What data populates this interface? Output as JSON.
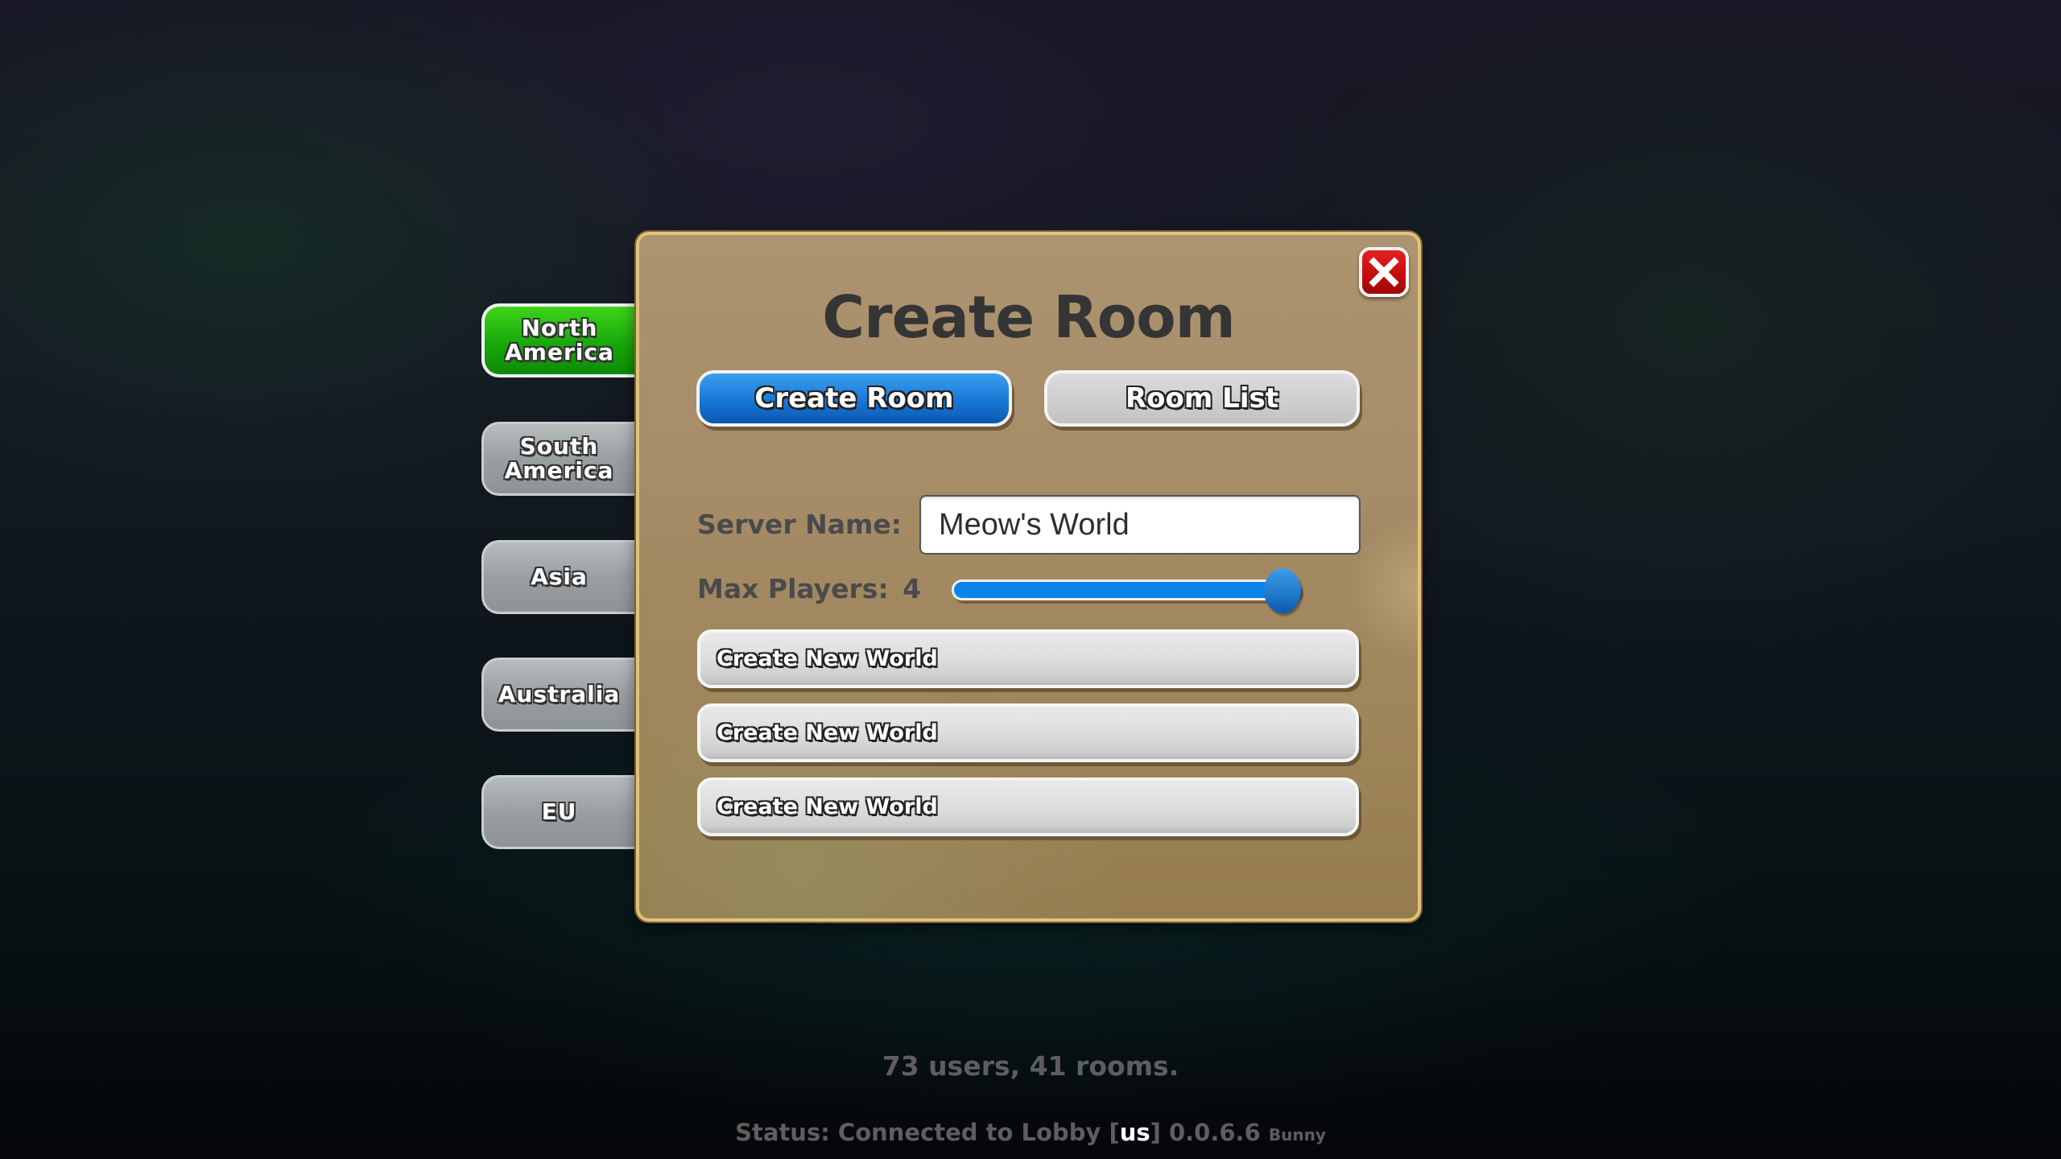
{
  "dialog": {
    "title": "Create Room",
    "close_icon": "close-x-icon",
    "tabs": [
      {
        "label": "Create Room",
        "active": true
      },
      {
        "label": "Room List",
        "active": false
      }
    ],
    "server_name": {
      "label": "Server Name:",
      "value": "Meow's World"
    },
    "max_players": {
      "label": "Max Players:",
      "value": "4",
      "slider_fraction": 1.0
    },
    "world_slots": [
      {
        "label": "Create New World"
      },
      {
        "label": "Create New World"
      },
      {
        "label": "Create New World"
      }
    ]
  },
  "regions": [
    {
      "label": "North America",
      "line1": "North",
      "line2": "America",
      "active": true
    },
    {
      "label": "South America",
      "line1": "South",
      "line2": "America",
      "active": false
    },
    {
      "label": "Asia",
      "line1": "Asia",
      "line2": "",
      "active": false
    },
    {
      "label": "Australia",
      "line1": "Australia",
      "line2": "",
      "active": false
    },
    {
      "label": "EU",
      "line1": "EU",
      "line2": "",
      "active": false
    }
  ],
  "footer": {
    "stats": "73 users, 41 rooms.",
    "status_prefix": "Status: Connected to Lobby [",
    "region_code": "us",
    "status_suffix": "] 0.0.6.6",
    "build_name": "Bunny"
  },
  "colors": {
    "active_region": "#18a80a",
    "active_tab": "#1877d6",
    "close_button": "#c10c0c",
    "panel": "#a58b66",
    "panel_border": "#e2c27a"
  }
}
